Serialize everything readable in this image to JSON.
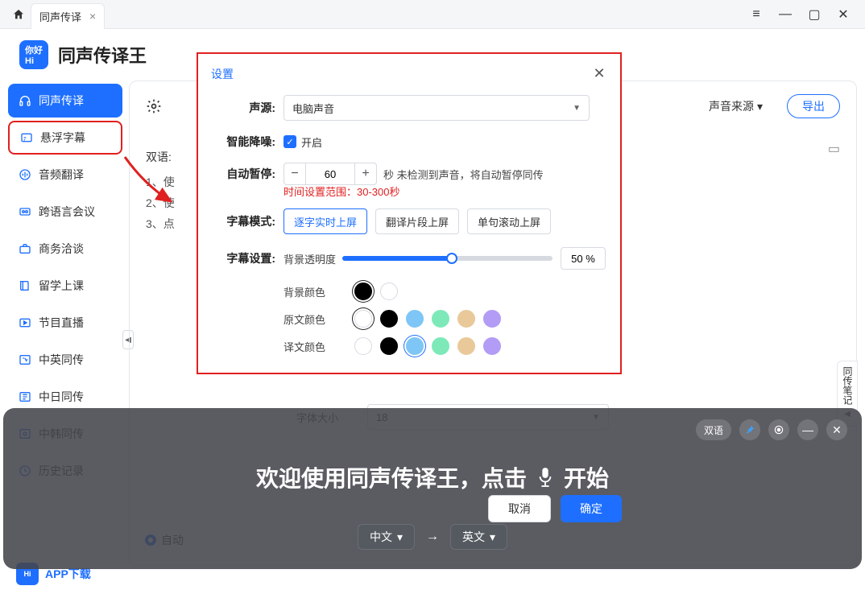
{
  "titlebar": {
    "tab_label": "同声传译"
  },
  "header": {
    "app_title": "同声传译王"
  },
  "sidebar": {
    "items": [
      {
        "label": "同声传译",
        "name": "nav-simultaneous",
        "active": true
      },
      {
        "label": "悬浮字幕",
        "name": "nav-floating-subtitle",
        "highlight": true
      },
      {
        "label": "音频翻译",
        "name": "nav-audio-translate"
      },
      {
        "label": "跨语言会议",
        "name": "nav-crosslang-meeting"
      },
      {
        "label": "商务洽谈",
        "name": "nav-business"
      },
      {
        "label": "留学上课",
        "name": "nav-study-class"
      },
      {
        "label": "节目直播",
        "name": "nav-live"
      },
      {
        "label": "中英同传",
        "name": "nav-cn-en"
      },
      {
        "label": "中日同传",
        "name": "nav-cn-jp"
      },
      {
        "label": "中韩同传",
        "name": "nav-cn-kr"
      },
      {
        "label": "历史记录",
        "name": "nav-history"
      }
    ],
    "app_download": "APP下载"
  },
  "content": {
    "sound_source_menu": "声音来源",
    "export": "导出",
    "bilingual_hint": "双语",
    "steps": [
      "1、使",
      "2、使",
      "3、点"
    ]
  },
  "settings": {
    "title": "设置",
    "labels": {
      "source": "声源:",
      "denoise": "智能降噪:",
      "autopause": "自动暂停:",
      "subtitle_mode": "字幕模式:",
      "subtitle_set": "字幕设置:",
      "bg_opacity": "背景透明度",
      "bg_color": "背景颜色",
      "orig_color": "原文颜色",
      "trans_color": "译文颜色",
      "font_size": "字体大小"
    },
    "source_value": "电脑声音",
    "denoise_label": "开启",
    "autopause_value": "60",
    "autopause_hint": "秒 未检测到声音，将自动暂停同传",
    "autopause_range": "时间设置范围：30-300秒",
    "modes": [
      "逐字实时上屏",
      "翻译片段上屏",
      "单句滚动上屏"
    ],
    "opacity_value": "50 %",
    "font_size_value": "18",
    "buttons": {
      "cancel": "取消",
      "ok": "确定"
    }
  },
  "side_notes": "同传笔记",
  "overlay": {
    "chip_bilingual": "双语",
    "welcome_pre": "欢迎使用同声传译王，点击",
    "welcome_post": "开始",
    "lang_from": "中文",
    "lang_to": "英文",
    "auto_label": "自动"
  }
}
